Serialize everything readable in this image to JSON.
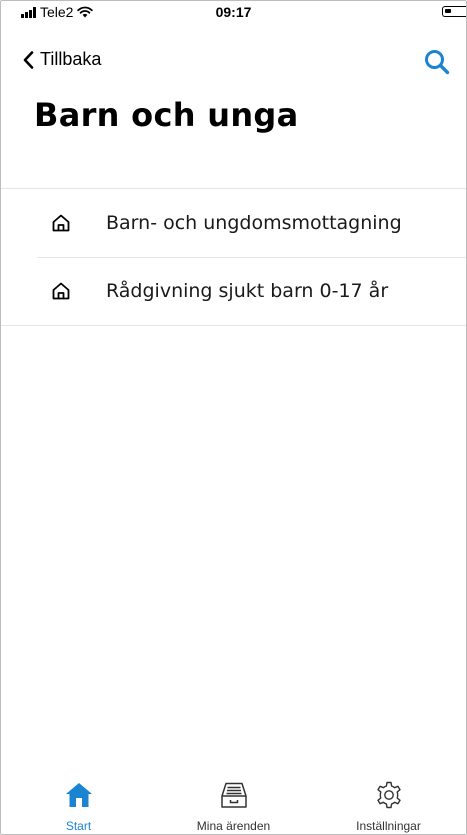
{
  "status_bar": {
    "carrier": "Tele2",
    "time": "09:17"
  },
  "nav": {
    "back_label": "Tillbaka",
    "search_icon": "search-icon"
  },
  "page_title": "Barn och unga",
  "list": [
    {
      "label": "Barn- och ungdomsmottagning",
      "icon": "home-icon"
    },
    {
      "label": "Rådgivning sjukt barn 0-17 år",
      "icon": "home-icon"
    }
  ],
  "tab_bar": {
    "tabs": [
      {
        "label": "Start",
        "icon": "home-filled-icon",
        "active": true
      },
      {
        "label": "Mina ärenden",
        "icon": "inbox-icon",
        "active": false
      },
      {
        "label": "Inställningar",
        "icon": "gear-icon",
        "active": false
      }
    ]
  },
  "colors": {
    "accent": "#1a84d1",
    "divider": "#e6e6e6",
    "text": "#000000"
  }
}
